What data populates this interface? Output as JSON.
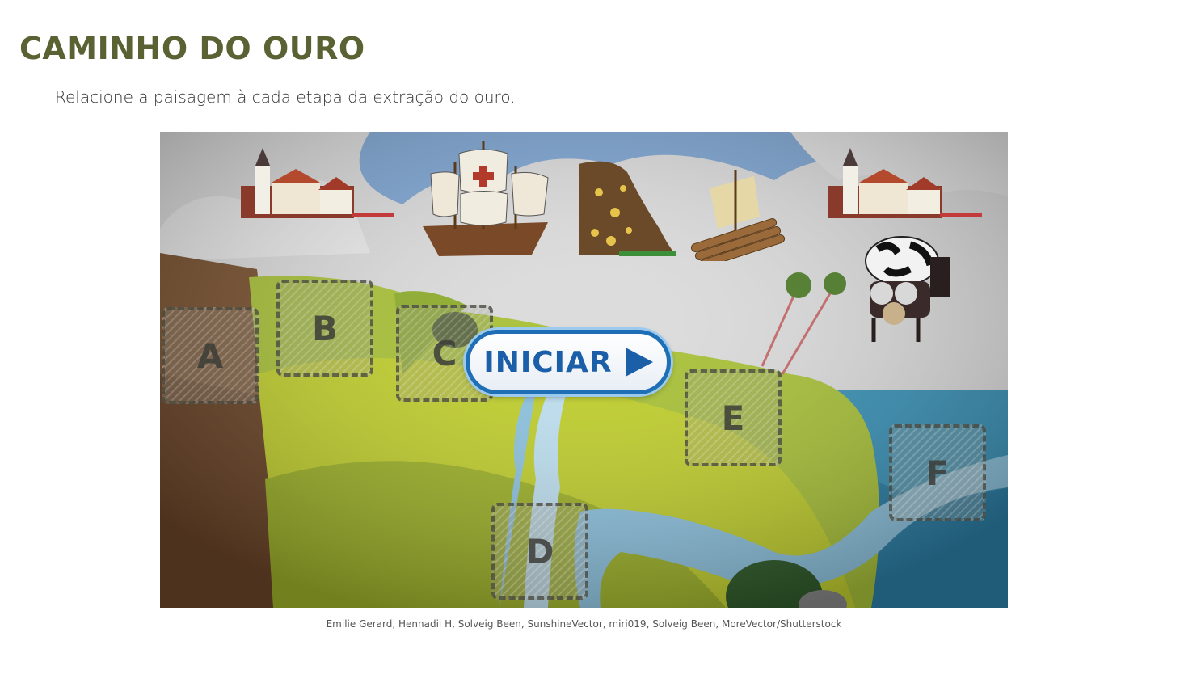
{
  "page": {
    "title": "CAMINHO DO OURO",
    "instruction": "Relacione a paisagem à cada etapa da extração do ouro.",
    "credits": "Emilie Gerard, Hennadii H, Solveig Been, SunshineVector, miri019, Solveig Been, MoreVector/Shutterstock"
  },
  "game": {
    "start_label": "INICIAR",
    "drop_zones": [
      {
        "label": "A"
      },
      {
        "label": "B"
      },
      {
        "label": "C"
      },
      {
        "label": "D"
      },
      {
        "label": "E"
      },
      {
        "label": "F"
      }
    ],
    "draggable_items": [
      {
        "name": "village-left"
      },
      {
        "name": "caravel-ship"
      },
      {
        "name": "gold-rock"
      },
      {
        "name": "wooden-raft"
      },
      {
        "name": "village-right"
      },
      {
        "name": "pack-mules"
      }
    ]
  },
  "colors": {
    "title": "#5a6132",
    "button_blue": "#1a5fa8"
  }
}
